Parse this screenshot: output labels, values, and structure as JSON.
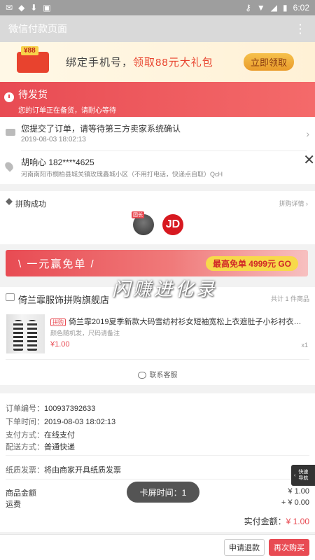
{
  "statusbar": {
    "time": "6:02"
  },
  "titlebar": {
    "title": "微信付款页面",
    "more": "⋮"
  },
  "phone_banner": {
    "amount": "¥88",
    "text_a": "绑定手机号，",
    "text_b": "领取88元大礼包",
    "button": "立即领取"
  },
  "order_status": {
    "title": "待发货",
    "subtitle": "您的订单正在备货，请耐心等待"
  },
  "logistics": {
    "text": "您提交了订单，请等待第三方卖家系统确认",
    "time": "2019-08-03 18:02:13"
  },
  "address": {
    "name_phone": "胡响心 182****4625",
    "address": "河南南阳市桐柏县城关镇玫瑰鑫城小区（不用打电话，快递点自取）QcH"
  },
  "group": {
    "title": "拼购成功",
    "detail": "拼购详情 ›",
    "leader_tag": "团长",
    "jd_logo": "JD"
  },
  "free_banner": {
    "text": "\\ 一元赢免单 /",
    "pill": "最高免单 4999元 GO"
  },
  "watermark": {
    "text": "闪赚进化录"
  },
  "store": {
    "name": "倚兰霏服饰拼购旗舰店",
    "count": "共计 1 件商品",
    "product": {
      "tag": "拼购",
      "name": "倚兰霏2019夏季新款大码雪纺衬衫女短袖宽松上衣遮肚子小衫衬衣潮Y16...",
      "spec": "颜色随机发，尺码请备注",
      "price": "¥1.00",
      "qty": "x1"
    },
    "contact": "联系客服"
  },
  "order_detail": {
    "order_no_label": "订单编号：",
    "order_no": "100937392633",
    "order_time_label": "下单时间：",
    "order_time": "2019-08-03 18:02:13",
    "pay_label": "支付方式：",
    "pay": "在线支付",
    "ship_label": "配送方式：",
    "ship": "普通快递",
    "invoice_label": "纸质发票：",
    "invoice": "将由商家开具纸质发票",
    "goods_amount_label": "商品金额",
    "goods_amount": "¥ 1.00",
    "freight_label": "运费",
    "freight": "+ ¥ 0.00",
    "total_label": "实付金额：",
    "total": "¥ 1.00"
  },
  "toast": {
    "text": "卡屏时间：1"
  },
  "quicknav": {
    "line1": "快速",
    "line2": "导航"
  },
  "bottom": {
    "refund": "申请退款",
    "rebuy": "再次购买"
  },
  "colors": {
    "accent": "#e84b53",
    "gold": "#f7d94a"
  }
}
